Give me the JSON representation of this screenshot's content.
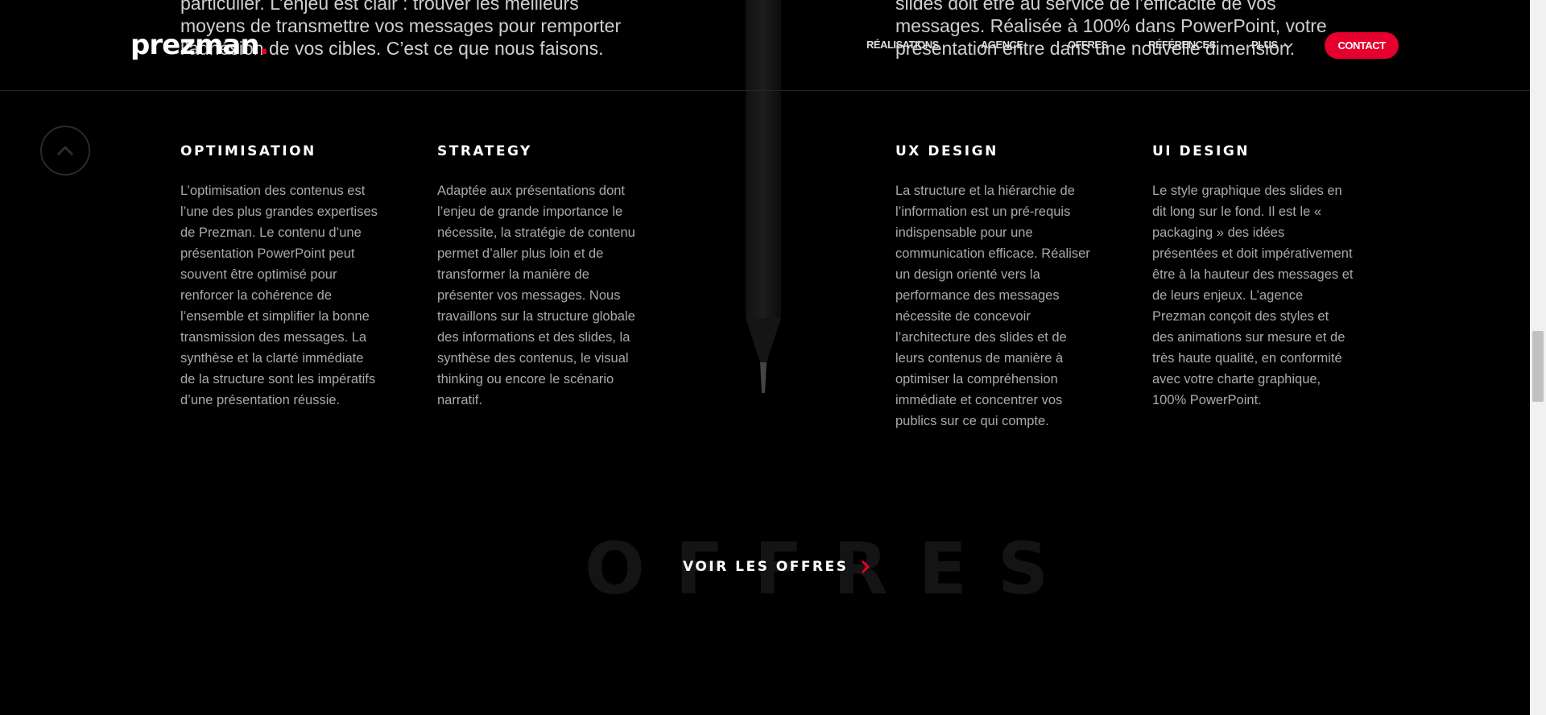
{
  "background_text": {
    "left": "particulier. L’enjeu est clair : trouver les meilleurs moyens de transmettre vos messages pour remporter l’adhésion de vos cibles. C’est ce que nous faisons.",
    "right": "slides doit être au service de l’efficacité de vos messages. Réalisée à 100% dans PowerPoint, votre présentation entre dans une nouvelle dimension."
  },
  "header": {
    "logo": "prezman",
    "logo_dot": ".",
    "nav": [
      "RÉALISATIONS",
      "AGENCE",
      "OFFRES",
      "RÉFÉRENCES",
      "PLUS"
    ],
    "contact": "CONTACT"
  },
  "columns": [
    {
      "title": "OPTIMISATION",
      "text": "L’optimisation des contenus est l’une des plus grandes expertises de Prezman. Le contenu d’une présentation PowerPoint peut souvent être optimisé pour renforcer la cohérence de l’ensemble et simplifier la bonne transmission des messages. La synthèse et la clarté immédiate de la structure sont les impératifs d’une présentation réussie."
    },
    {
      "title": "STRATEGY",
      "text": "Adaptée aux présentations dont l’enjeu de grande importance le nécessite, la stratégie de contenu permet d’aller plus loin et de transformer la manière de présenter vos messages. Nous travaillons sur la structure globale des informations et des slides, la synthèse des contenus, le visual thinking ou encore le scénario narratif."
    },
    {
      "title": "UX DESIGN",
      "text": "La structure et la hiérarchie de l’information est un pré-requis indispensable pour une communication efficace. Réaliser un design orienté vers la performance des messages nécessite de concevoir l’architecture des slides et de leurs contenus de manière à optimiser la compréhension immédiate et concentrer vos publics sur ce qui compte."
    },
    {
      "title": "UI DESIGN",
      "text": "Le style graphique des slides en dit long sur le fond. Il est le « packaging » des idées présentées et doit impérativement être à la hauteur des messages et de leurs enjeux. L’agence Prezman conçoit des styles et des animations sur mesure et de très haute qualité, en conformité avec votre charte graphique, 100% PowerPoint."
    }
  ],
  "offres": {
    "watermark": "OFFRES",
    "cta": "VOIR LES OFFRES"
  },
  "colors": {
    "accent": "#e5002d",
    "background": "#000000",
    "body_text": "#a9a9a9"
  },
  "icons": {
    "scroll_up": "chevron-up-icon",
    "cta_arrow": "chevron-right-icon",
    "nav_more": "chevron-down-icon"
  }
}
